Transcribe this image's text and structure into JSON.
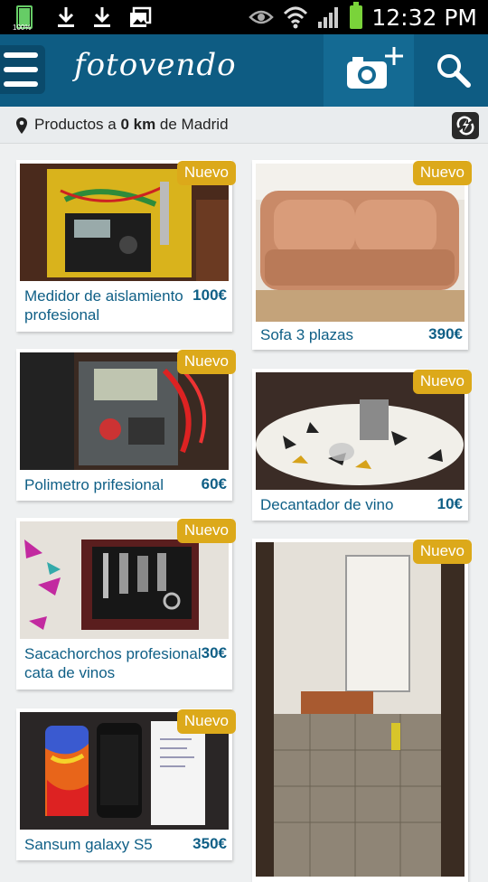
{
  "status_bar": {
    "battery_left_pct": "100%",
    "time": "12:32 PM"
  },
  "header": {
    "logo_text": "fotovendo",
    "menu_icon": "hamburger-icon",
    "camera_icon": "camera-plus-icon",
    "search_icon": "search-icon",
    "colors": {
      "header_bg": "#0e5c83",
      "badge": "#dca91a",
      "text": "#0f5f86"
    }
  },
  "location": {
    "prefix": "Productos a ",
    "distance": "0 km",
    "suffix": " de Madrid"
  },
  "products": [
    {
      "title": "Medidor de aislamiento profesional",
      "price": "100€",
      "badge": "Nuevo"
    },
    {
      "title": "Sofa 3 plazas",
      "price": "390€",
      "badge": "Nuevo"
    },
    {
      "title": "Polimetro prifesional",
      "price": "60€",
      "badge": "Nuevo"
    },
    {
      "title": "Decantador de vino",
      "price": "10€",
      "badge": "Nuevo"
    },
    {
      "title": "Sacachorchos profesional cata de vinos",
      "price": "30€",
      "badge": "Nuevo"
    },
    {
      "title": "",
      "price": "",
      "badge": "Nuevo"
    },
    {
      "title": "Sansum galaxy S5",
      "price": "350€",
      "badge": "Nuevo"
    }
  ]
}
